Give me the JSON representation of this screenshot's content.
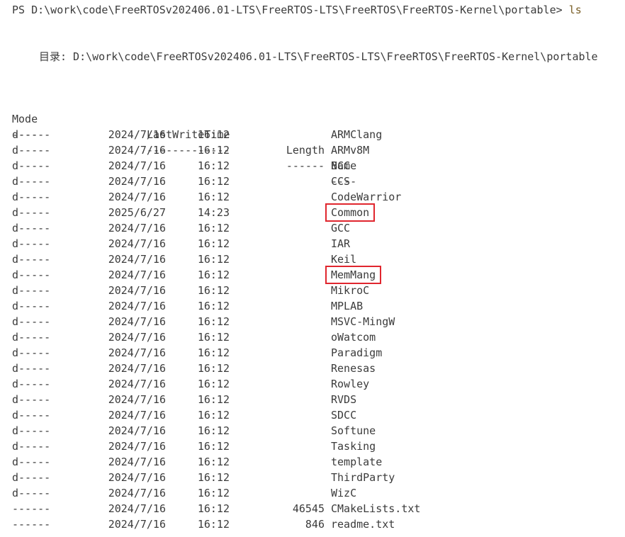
{
  "prompt": {
    "prefix": "PS D:\\work\\code\\FreeRTOSv202406.01-LTS\\FreeRTOS-LTS\\FreeRTOS\\FreeRTOS-Kernel\\portable> ",
    "command": "ls"
  },
  "directory_line": "目录: D:\\work\\code\\FreeRTOSv202406.01-LTS\\FreeRTOS-LTS\\FreeRTOS\\FreeRTOS-Kernel\\portable",
  "headers": {
    "mode": "Mode",
    "last_write_time": "LastWriteTime",
    "length": "Length",
    "name": "Name"
  },
  "separators": {
    "mode": "----",
    "last_write_time": "-------------",
    "length": "------",
    "name": "----"
  },
  "entries": [
    {
      "mode": "d-----",
      "date": "2024/7/16",
      "time": "16:12",
      "length": "",
      "name": "ARMClang",
      "highlighted": false
    },
    {
      "mode": "d-----",
      "date": "2024/7/16",
      "time": "16:12",
      "length": "",
      "name": "ARMv8M",
      "highlighted": false
    },
    {
      "mode": "d-----",
      "date": "2024/7/16",
      "time": "16:12",
      "length": "",
      "name": "BCC",
      "highlighted": false
    },
    {
      "mode": "d-----",
      "date": "2024/7/16",
      "time": "16:12",
      "length": "",
      "name": "CCS",
      "highlighted": false
    },
    {
      "mode": "d-----",
      "date": "2024/7/16",
      "time": "16:12",
      "length": "",
      "name": "CodeWarrior",
      "highlighted": false
    },
    {
      "mode": "d-----",
      "date": "2025/6/27",
      "time": "14:23",
      "length": "",
      "name": "Common",
      "highlighted": true
    },
    {
      "mode": "d-----",
      "date": "2024/7/16",
      "time": "16:12",
      "length": "",
      "name": "GCC",
      "highlighted": false
    },
    {
      "mode": "d-----",
      "date": "2024/7/16",
      "time": "16:12",
      "length": "",
      "name": "IAR",
      "highlighted": false
    },
    {
      "mode": "d-----",
      "date": "2024/7/16",
      "time": "16:12",
      "length": "",
      "name": "Keil",
      "highlighted": false
    },
    {
      "mode": "d-----",
      "date": "2024/7/16",
      "time": "16:12",
      "length": "",
      "name": "MemMang",
      "highlighted": true
    },
    {
      "mode": "d-----",
      "date": "2024/7/16",
      "time": "16:12",
      "length": "",
      "name": "MikroC",
      "highlighted": false
    },
    {
      "mode": "d-----",
      "date": "2024/7/16",
      "time": "16:12",
      "length": "",
      "name": "MPLAB",
      "highlighted": false
    },
    {
      "mode": "d-----",
      "date": "2024/7/16",
      "time": "16:12",
      "length": "",
      "name": "MSVC-MingW",
      "highlighted": false
    },
    {
      "mode": "d-----",
      "date": "2024/7/16",
      "time": "16:12",
      "length": "",
      "name": "oWatcom",
      "highlighted": false
    },
    {
      "mode": "d-----",
      "date": "2024/7/16",
      "time": "16:12",
      "length": "",
      "name": "Paradigm",
      "highlighted": false
    },
    {
      "mode": "d-----",
      "date": "2024/7/16",
      "time": "16:12",
      "length": "",
      "name": "Renesas",
      "highlighted": false
    },
    {
      "mode": "d-----",
      "date": "2024/7/16",
      "time": "16:12",
      "length": "",
      "name": "Rowley",
      "highlighted": false
    },
    {
      "mode": "d-----",
      "date": "2024/7/16",
      "time": "16:12",
      "length": "",
      "name": "RVDS",
      "highlighted": false
    },
    {
      "mode": "d-----",
      "date": "2024/7/16",
      "time": "16:12",
      "length": "",
      "name": "SDCC",
      "highlighted": false
    },
    {
      "mode": "d-----",
      "date": "2024/7/16",
      "time": "16:12",
      "length": "",
      "name": "Softune",
      "highlighted": false
    },
    {
      "mode": "d-----",
      "date": "2024/7/16",
      "time": "16:12",
      "length": "",
      "name": "Tasking",
      "highlighted": false
    },
    {
      "mode": "d-----",
      "date": "2024/7/16",
      "time": "16:12",
      "length": "",
      "name": "template",
      "highlighted": false
    },
    {
      "mode": "d-----",
      "date": "2024/7/16",
      "time": "16:12",
      "length": "",
      "name": "ThirdParty",
      "highlighted": false
    },
    {
      "mode": "d-----",
      "date": "2024/7/16",
      "time": "16:12",
      "length": "",
      "name": "WizC",
      "highlighted": false
    },
    {
      "mode": "------",
      "date": "2024/7/16",
      "time": "16:12",
      "length": "46545",
      "name": "CMakeLists.txt",
      "highlighted": false
    },
    {
      "mode": "------",
      "date": "2024/7/16",
      "time": "16:12",
      "length": "846",
      "name": "readme.txt",
      "highlighted": false
    }
  ],
  "colors": {
    "text": "#3b3b3b",
    "command": "#795e26",
    "highlight_box": "#e0262e",
    "background": "#ffffff"
  }
}
